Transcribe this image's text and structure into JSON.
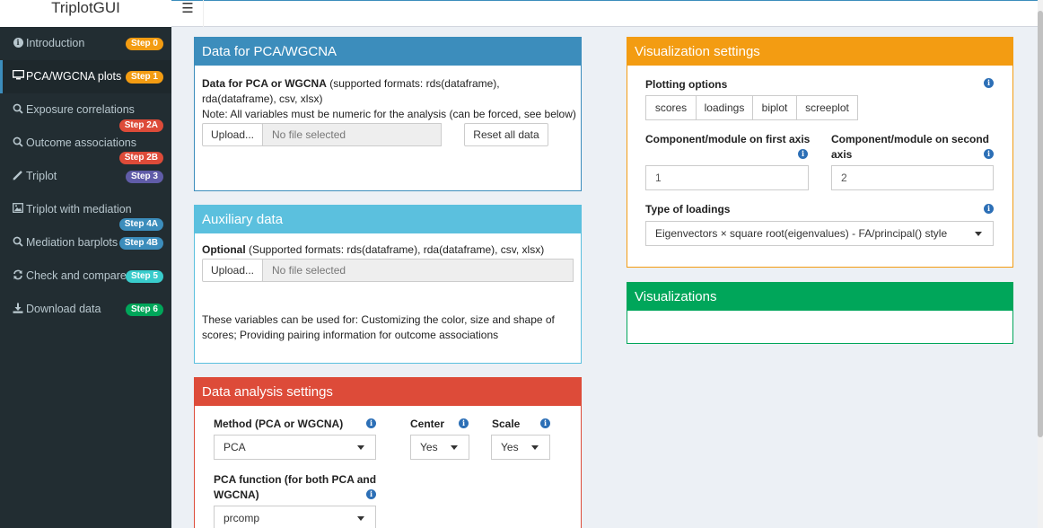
{
  "app": {
    "title": "TriplotGUI",
    "menu_icon": "☰"
  },
  "sidebar": {
    "items": [
      {
        "label": "Introduction",
        "icon": "info-icon",
        "badge": "Step 0",
        "badge_color": "#f39c12",
        "active": false
      },
      {
        "label": "PCA/WGCNA plots",
        "icon": "desktop-icon",
        "badge": "Step 1",
        "badge_color": "#f39c12",
        "active": true
      },
      {
        "label": "Exposure correlations",
        "icon": "search-icon",
        "badge": "Step 2A",
        "badge_color": "#dd4b39",
        "active": false
      },
      {
        "label": "Outcome associations",
        "icon": "search-icon",
        "badge": "Step 2B",
        "badge_color": "#dd4b39",
        "active": false
      },
      {
        "label": "Triplot",
        "icon": "pencil-icon",
        "badge": "Step 3",
        "badge_color": "#605ca8",
        "active": false
      },
      {
        "label": "Triplot with mediation",
        "icon": "image-icon",
        "badge": "Step 4A",
        "badge_color": "#3c8dbc",
        "active": false
      },
      {
        "label": "Mediation barplots",
        "icon": "search-icon",
        "badge": "Step 4B",
        "badge_color": "#3c8dbc",
        "active": false
      },
      {
        "label": "Check and compare",
        "icon": "refresh-icon",
        "badge": "Step 5",
        "badge_color": "#39cccc",
        "active": false
      },
      {
        "label": "Download data",
        "icon": "download-icon",
        "badge": "Step 6",
        "badge_color": "#00a65a",
        "active": false
      }
    ]
  },
  "data_box": {
    "title": "Data for PCA/WGCNA",
    "desc_bold": "Data for PCA or WGCNA",
    "desc_rest": " (supported formats: rds(dataframe), rda(dataframe), csv, xlsx)",
    "note": "Note: All variables must be numeric for the analysis (can be forced, see below)",
    "upload_label": "Upload...",
    "file_placeholder": "No file selected",
    "reset_label": "Reset all data",
    "color": "#3c8dbc"
  },
  "aux_box": {
    "title": "Auxiliary data",
    "desc_bold": "Optional",
    "desc_rest": " (Supported formats: rds(dataframe), rda(dataframe), csv, xlsx)",
    "upload_label": "Upload...",
    "file_placeholder": "No file selected",
    "usage": "These variables can be used for: Customizing the color, size and shape of scores; Providing pairing information for outcome associations",
    "color": "#5bc0de"
  },
  "analysis_box": {
    "title": "Data analysis settings",
    "method_label": "Method (PCA or WGCNA)",
    "method_value": "PCA",
    "center_label": "Center",
    "center_value": "Yes",
    "scale_label": "Scale",
    "scale_value": "Yes",
    "pca_fn_label": "PCA function (for both PCA and WGCNA)",
    "pca_fn_value": "prcomp",
    "color": "#dd4b39"
  },
  "vis_settings": {
    "title": "Visualization settings",
    "plotting_label": "Plotting options",
    "plot_options": [
      "scores",
      "loadings",
      "biplot",
      "screeplot"
    ],
    "first_axis_label": "Component/module on first axis",
    "first_axis_value": "1",
    "second_axis_label": "Component/module on second axis",
    "second_axis_value": "2",
    "loadings_type_label": "Type of loadings",
    "loadings_type_value": "Eigenvectors × square root(eigenvalues) - FA/principal() style",
    "color": "#f39c12"
  },
  "visualizations": {
    "title": "Visualizations",
    "color": "#00a65a"
  }
}
